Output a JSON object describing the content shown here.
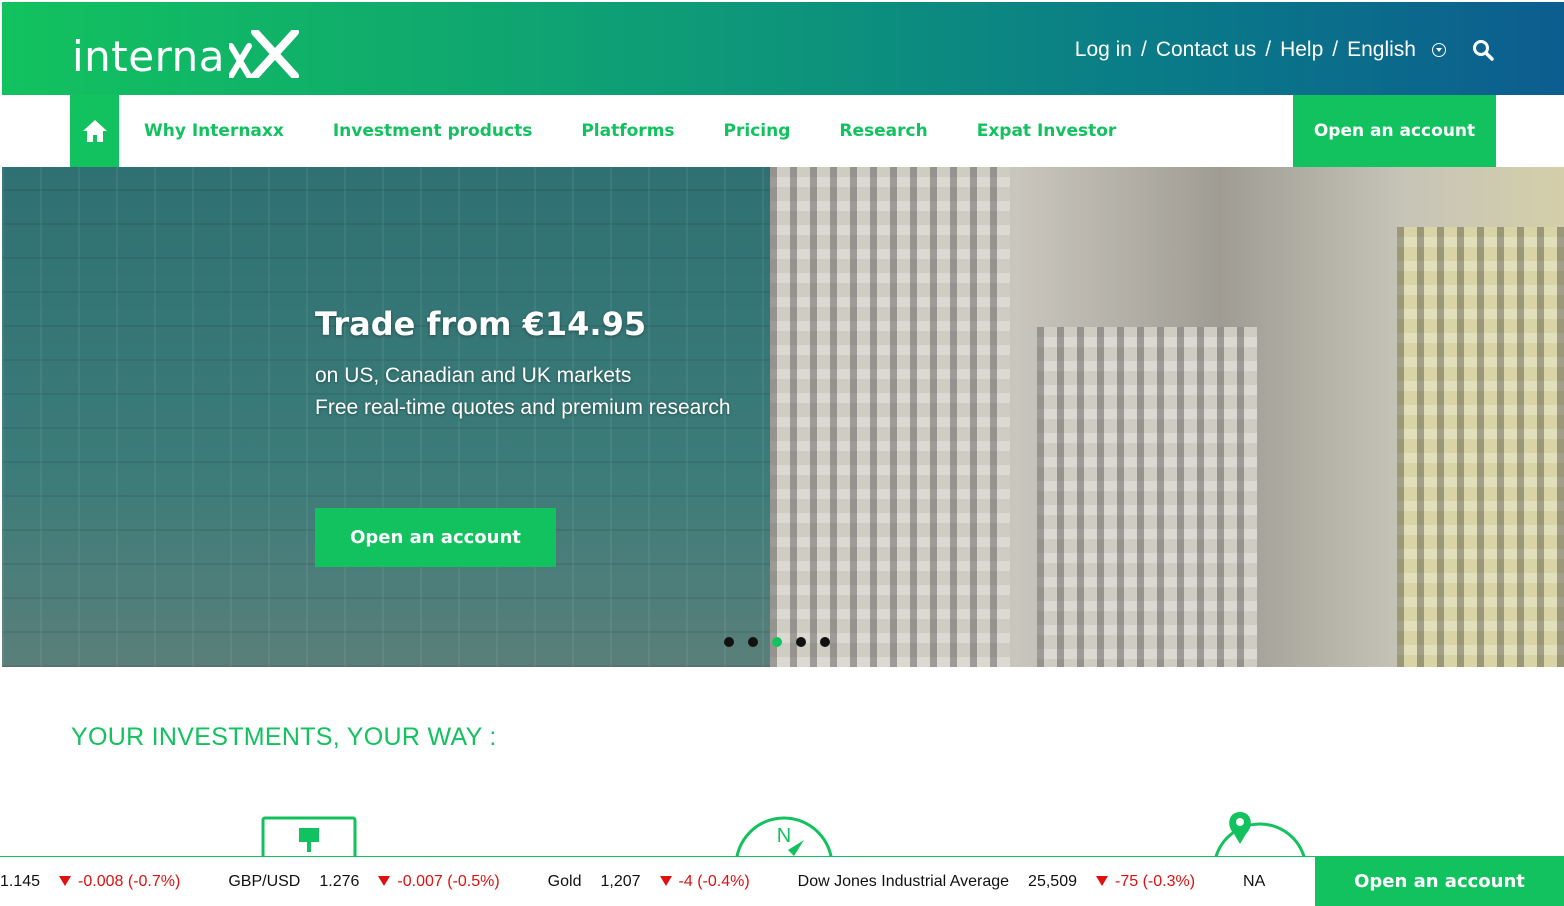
{
  "header": {
    "logo_text": "interna",
    "logo_mark": "xX",
    "links": [
      {
        "label": "Log in"
      },
      {
        "label": "Contact us"
      },
      {
        "label": "Help"
      },
      {
        "label": "English"
      }
    ],
    "separator": "/",
    "icons": [
      "home-icon",
      "language-dropdown-icon",
      "search-icon"
    ]
  },
  "nav": {
    "items": [
      "Why Internaxx",
      "Investment products",
      "Platforms",
      "Pricing",
      "Research",
      "Expat Investor"
    ],
    "cta": "Open an account"
  },
  "hero": {
    "title": "Trade from €14.95",
    "line1": "on US, Canadian and UK markets",
    "line2": "Free real-time quotes and premium research",
    "cta": "Open an account",
    "slides_total": 5,
    "active_slide": 3
  },
  "section": {
    "title": "YOUR INVESTMENTS, YOUR WAY :",
    "feature_icons": [
      "screen-icon",
      "compass-icon",
      "globe-pin-icon"
    ]
  },
  "ticker": {
    "items": [
      {
        "name": "",
        "value": "1.145",
        "change": "-0.008",
        "pct": "(-0.7%)"
      },
      {
        "name": "GBP/USD",
        "value": "1.276",
        "change": "-0.007",
        "pct": "(-0.5%)"
      },
      {
        "name": "Gold",
        "value": "1,207",
        "change": "-4",
        "pct": "(-0.4%)"
      },
      {
        "name": "Dow Jones Industrial Average",
        "value": "25,509",
        "change": "-75",
        "pct": "(-0.3%)"
      },
      {
        "name": "NA",
        "value": "",
        "change": "",
        "pct": ""
      }
    ],
    "cta": "Open an account"
  },
  "colors": {
    "brand_green": "#12c25e",
    "header_blue": "#0c5d8f",
    "down_red": "#e01010"
  }
}
